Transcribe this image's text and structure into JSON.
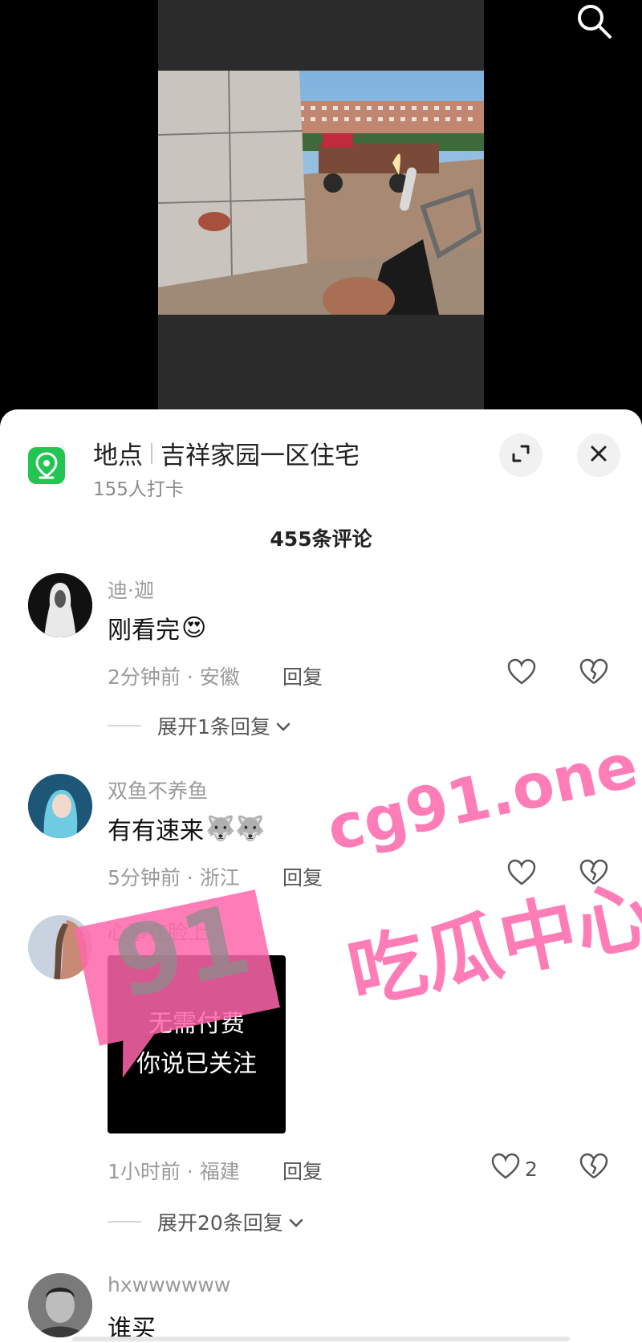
{
  "location": {
    "label": "地点",
    "place": "吉祥家园一区住宅",
    "checkins": "155人打卡"
  },
  "comments_header": "455条评论",
  "comments": [
    {
      "user": "迪·迦",
      "text": "刚看完",
      "emoji": "😍",
      "time_loc": "2分钟前 · 安徽",
      "reply": "回复",
      "expand": "展开1条回复"
    },
    {
      "user": "双鱼不养鱼",
      "text": "有有速来",
      "emoji": "🐺🐺",
      "time_loc": "5分钟前 · 浙江",
      "reply": "回复"
    },
    {
      "user": "心事在脸上",
      "image_lines": [
        "无需付费",
        "你说已关注"
      ],
      "time_loc": "1小时前 · 福建",
      "reply": "回复",
      "likes": "2",
      "expand": "展开20条回复"
    },
    {
      "user": "hxwwwwww",
      "text": "谁买"
    }
  ],
  "watermark": {
    "badge": "91",
    "domain": "cg91.one",
    "slogan": "吃瓜中心"
  },
  "colors": {
    "location_icon": "#23c552",
    "watermark": "#ff66aa",
    "sheet_bg": "#ffffff"
  }
}
